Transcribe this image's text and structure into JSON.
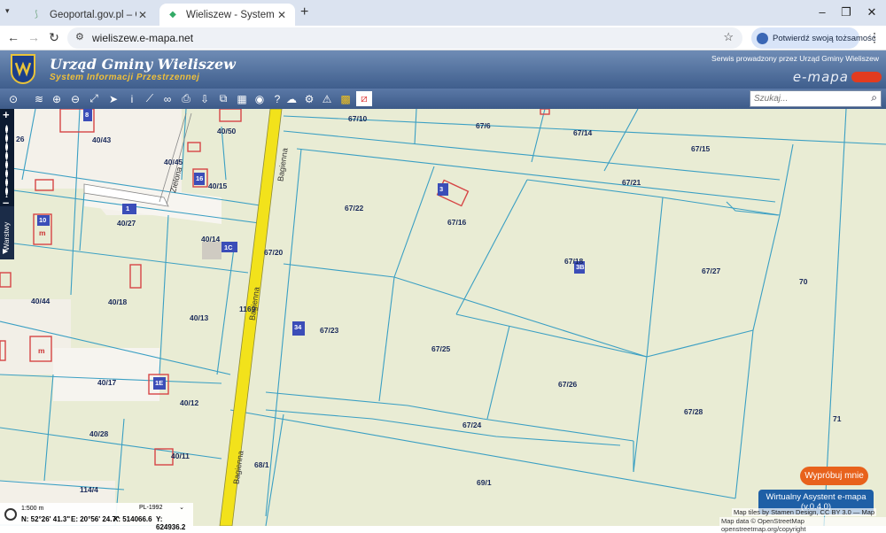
{
  "browser": {
    "tabs": [
      {
        "title": "Geoportal.gov.pl – Geoportal Infr",
        "active": false
      },
      {
        "title": "Wieliszew - System Informacji Pr",
        "active": true
      }
    ],
    "new_tab": "+",
    "window_controls": {
      "minimize": "–",
      "maximize": "❐",
      "close": "✕"
    },
    "url": "wieliszew.e-mapa.net",
    "identity_button": "Potwierdź swoją tożsamość"
  },
  "header": {
    "title": "Urząd Gminy Wieliszew",
    "subtitle": "System Informacji Przestrzennej",
    "served_by": "Serwis prowadzony przez Urząd Gminy Wieliszew",
    "brand": "e-mapa"
  },
  "toolbar": {
    "search_placeholder": "Szukaj...",
    "tools": [
      "overview-icon",
      "layers-icon",
      "zoom-in-icon",
      "zoom-out-icon",
      "full-extent-icon",
      "select-pointer-icon",
      "info-icon",
      "measure-icon",
      "link-icon",
      "print-icon",
      "download-icon",
      "export-icon",
      "flag-icon",
      "comment-icon",
      "help-icon",
      "cloud-icon",
      "settings-icon",
      "warning-icon",
      "grid-icon",
      "no-fill-icon"
    ]
  },
  "side": {
    "zoom_in": "+",
    "zoom_out": "–",
    "layers_label": "Warstwy"
  },
  "map": {
    "parcels": [
      "67/10",
      "67/6",
      "67/14",
      "40/50",
      "40/43",
      "26",
      "67/15",
      "40/45",
      "67/21",
      "40/15",
      "67/22",
      "67/16",
      "40/27",
      "40/14",
      "67/20",
      "67/18",
      "67/27",
      "40/44",
      "40/18",
      "70",
      "40/13",
      "1169",
      "67/23",
      "67/25",
      "40/17",
      "67/26",
      "40/12",
      "67/28",
      "71",
      "67/24",
      "40/28",
      "40/11",
      "68/1",
      "69/1",
      "114/4"
    ],
    "building_numbers": [
      "8",
      "16",
      "1",
      "10",
      "1C",
      "3",
      "3B",
      "34",
      "1E"
    ],
    "building_letters": [
      "m",
      "m"
    ],
    "streets": [
      "Bagienna",
      "Zielona",
      "Bagienna",
      "Bagienna"
    ]
  },
  "status": {
    "scale": "1:500 m",
    "crs": "PL-1992",
    "n": "N: 52°26' 41.3\"",
    "e": "E: 20°56' 24.7\"",
    "x": "X: 514066.6",
    "y": "Y: 624936.2"
  },
  "buttons": {
    "try": "Wypróbuj mnie",
    "assistant_line1": "Wirtualny Asystent e-mapa",
    "assistant_line2": "(v.0.4.0)"
  },
  "attribution": {
    "tiles": "Map tiles by Stamen Design, CC BY 3.0 — Map",
    "data": "Map data © OpenStreetMap openstreetmap.org/copyright"
  },
  "colors": {
    "parcel_fill": "#e9ecd3",
    "parcel_line": "#3a9fc3",
    "road": "#f0e11c",
    "building": "#d64545",
    "header": "#4c6a98",
    "try_button": "#e8621c",
    "assistant_button": "#1e5fa6"
  }
}
